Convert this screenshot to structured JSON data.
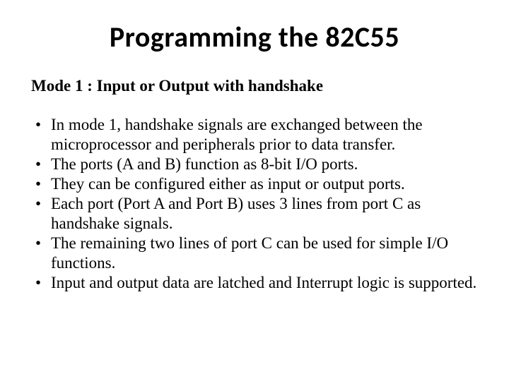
{
  "title": "Programming the 82C55",
  "subheading": "Mode 1 : Input or Output with handshake",
  "bullets": [
    "In mode 1, handshake signals are exchanged between the microprocessor and peripherals prior to data transfer.",
    "The ports (A and B) function as 8-bit I/O ports.",
    "They can be configured either as input or output ports.",
    "Each port (Port A and Port B) uses 3 lines from port C as handshake signals.",
    "The remaining two lines of port C can be used for simple I/O functions.",
    "Input and output data are latched and Interrupt logic is supported."
  ]
}
